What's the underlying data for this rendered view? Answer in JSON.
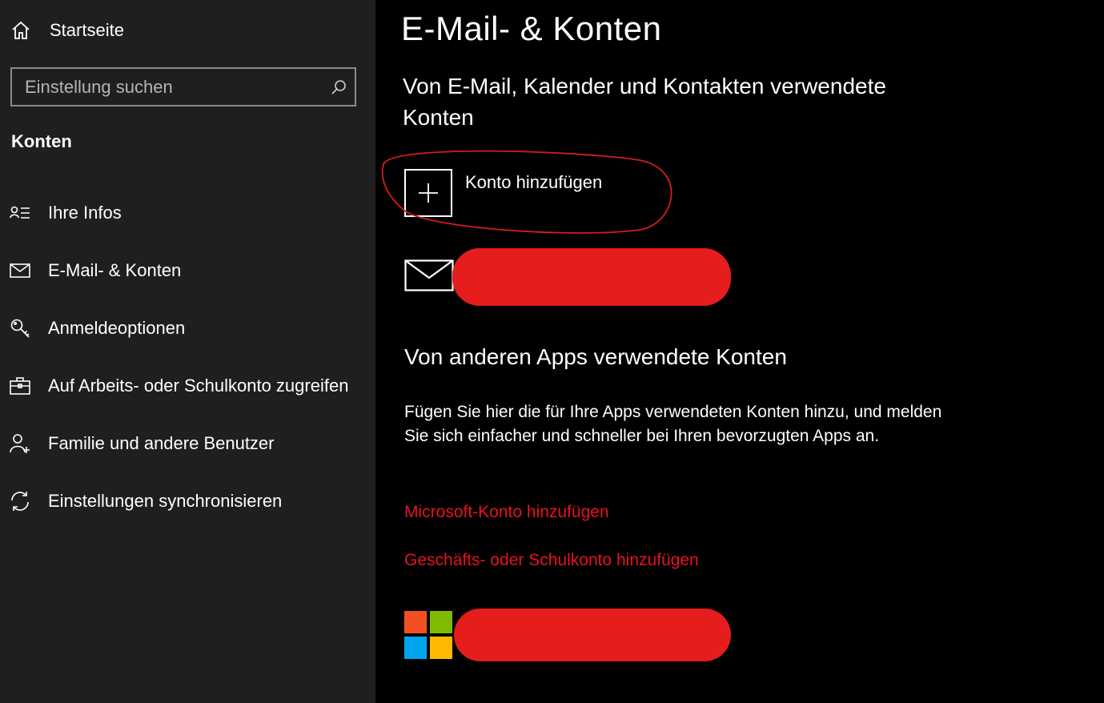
{
  "sidebar": {
    "home_label": "Startseite",
    "search_placeholder": "Einstellung suchen",
    "section_title": "Konten",
    "items": [
      {
        "label": "Ihre Infos",
        "icon": "person-list-icon"
      },
      {
        "label": "E-Mail- & Konten",
        "icon": "mail-icon"
      },
      {
        "label": "Anmeldeoptionen",
        "icon": "key-icon"
      },
      {
        "label": "Auf Arbeits- oder Schulkonto zugreifen",
        "icon": "briefcase-icon"
      },
      {
        "label": "Familie und andere Benutzer",
        "icon": "person-add-icon"
      },
      {
        "label": "Einstellungen synchronisieren",
        "icon": "sync-icon"
      }
    ]
  },
  "main": {
    "title": "E-Mail- & Konten",
    "section1_title": "Von E-Mail, Kalender und Kontakten verwendete Konten",
    "add_account_label": "Konto hinzufügen",
    "section2_title": "Von anderen Apps verwendete Konten",
    "section2_desc": "Fügen Sie hier die für Ihre Apps verwendeten Konten hinzu, und melden Sie sich einfacher und schneller bei Ihren bevorzugten Apps an.",
    "link_microsoft": "Microsoft-Konto hinzufügen",
    "link_work": "Geschäfts- oder Schulkonto hinzufügen"
  },
  "colors": {
    "background": "#000000",
    "sidebar": "#1f1f1f",
    "accent_link": "#e81123",
    "redaction": "#e51d1d",
    "ms_red": "#f25022",
    "ms_green": "#7fba00",
    "ms_blue": "#00a4ef",
    "ms_yellow": "#ffb900"
  }
}
